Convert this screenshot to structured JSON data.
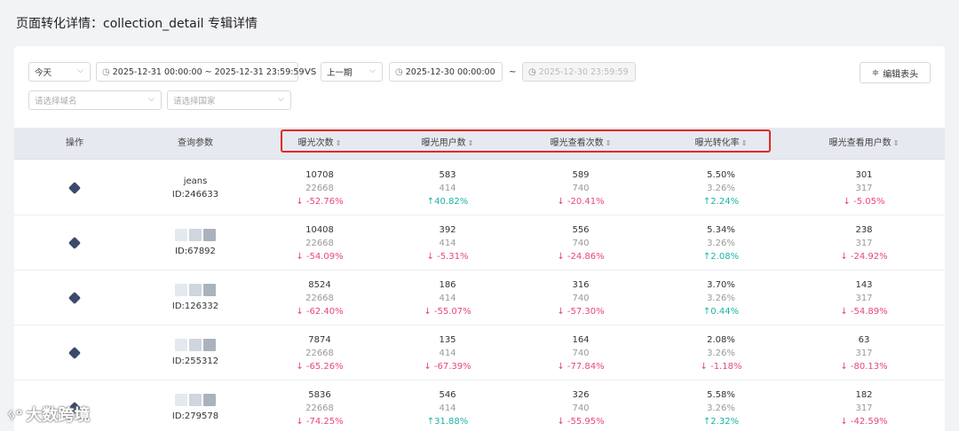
{
  "page_title": "页面转化详情：collection_detail 专辑详情",
  "filters": {
    "period": "今天",
    "date_range": "2025-12-31 00:00:00 ~ 2025-12-31 23:59:59",
    "vs_label": "VS",
    "compare_period": "上一期",
    "compare_start": "2025-12-30 00:00:00",
    "range_sep": "~",
    "compare_end": "2025-12-30 23:59:59",
    "domain_placeholder": "请选择域名",
    "country_placeholder": "请选择国家",
    "edit_header_label": "编辑表头"
  },
  "columns": [
    "操作",
    "查询参数",
    "曝光次数",
    "曝光用户数",
    "曝光查看次数",
    "曝光转化率",
    "曝光查看用户数"
  ],
  "rows": [
    {
      "name": "jeans",
      "id": "ID:246633",
      "c": [
        [
          "10708",
          "22668",
          "↓ -52.76%",
          "down"
        ],
        [
          "583",
          "414",
          "↑40.82%",
          "up"
        ],
        [
          "589",
          "740",
          "↓ -20.41%",
          "down"
        ],
        [
          "5.50%",
          "3.26%",
          "↑2.24%",
          "up"
        ],
        [
          "301",
          "317",
          "↓ -5.05%",
          "down"
        ]
      ]
    },
    {
      "name": "",
      "id": "ID:67892",
      "c": [
        [
          "10408",
          "22668",
          "↓ -54.09%",
          "down"
        ],
        [
          "392",
          "414",
          "↓ -5.31%",
          "down"
        ],
        [
          "556",
          "740",
          "↓ -24.86%",
          "down"
        ],
        [
          "5.34%",
          "3.26%",
          "↑2.08%",
          "up"
        ],
        [
          "238",
          "317",
          "↓ -24.92%",
          "down"
        ]
      ]
    },
    {
      "name": "",
      "id": "ID:126332",
      "c": [
        [
          "8524",
          "22668",
          "↓ -62.40%",
          "down"
        ],
        [
          "186",
          "414",
          "↓ -55.07%",
          "down"
        ],
        [
          "316",
          "740",
          "↓ -57.30%",
          "down"
        ],
        [
          "3.70%",
          "3.26%",
          "↑0.44%",
          "up"
        ],
        [
          "143",
          "317",
          "↓ -54.89%",
          "down"
        ]
      ]
    },
    {
      "name": "",
      "id": "ID:255312",
      "c": [
        [
          "7874",
          "22668",
          "↓ -65.26%",
          "down"
        ],
        [
          "135",
          "414",
          "↓ -67.39%",
          "down"
        ],
        [
          "164",
          "740",
          "↓ -77.84%",
          "down"
        ],
        [
          "2.08%",
          "3.26%",
          "↓ -1.18%",
          "down"
        ],
        [
          "63",
          "317",
          "↓ -80.13%",
          "down"
        ]
      ]
    },
    {
      "name": "",
      "id": "ID:279578",
      "c": [
        [
          "5836",
          "22668",
          "↓ -74.25%",
          "down"
        ],
        [
          "546",
          "414",
          "↑31.88%",
          "up"
        ],
        [
          "326",
          "740",
          "↓ -55.95%",
          "down"
        ],
        [
          "5.58%",
          "3.26%",
          "↑2.32%",
          "up"
        ],
        [
          "182",
          "317",
          "↓ -42.59%",
          "down"
        ]
      ]
    }
  ],
  "watermark": "大数跨境"
}
